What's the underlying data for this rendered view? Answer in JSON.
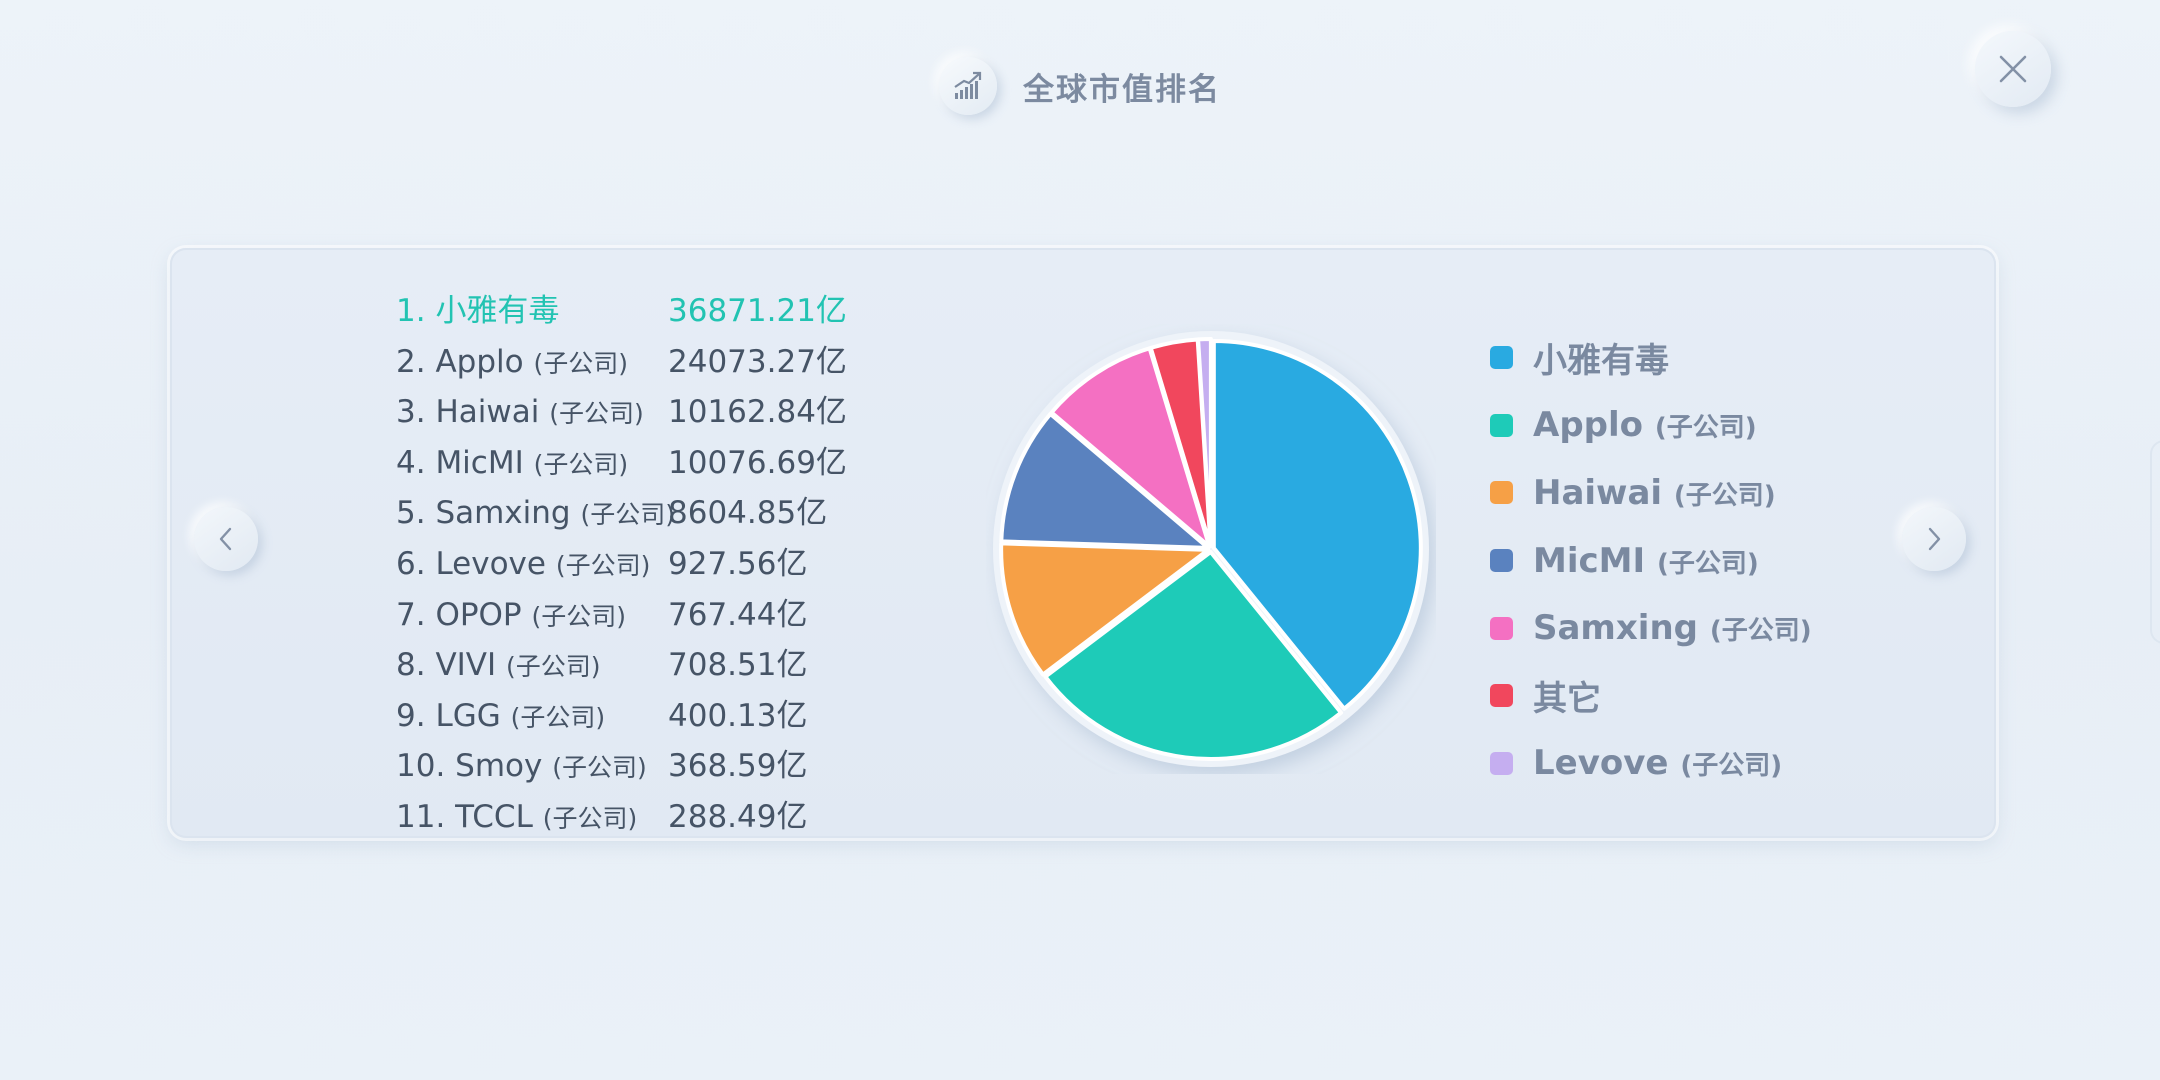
{
  "header": {
    "title": "全球市值排名",
    "icon": "growth-chart-icon"
  },
  "controls": {
    "close_icon": "close-icon",
    "prev_icon": "chevron-left-icon",
    "next_icon": "chevron-right-icon"
  },
  "ranking": [
    {
      "rank": "1.",
      "name": "小雅有毒",
      "tag": "",
      "value": "36871.21亿",
      "highlight": true
    },
    {
      "rank": "2.",
      "name": "Applo",
      "tag": "(子公司)",
      "value": "24073.27亿",
      "highlight": false
    },
    {
      "rank": "3.",
      "name": "Haiwai",
      "tag": "(子公司)",
      "value": "10162.84亿",
      "highlight": false
    },
    {
      "rank": "4.",
      "name": "MicMI",
      "tag": "(子公司)",
      "value": "10076.69亿",
      "highlight": false
    },
    {
      "rank": "5.",
      "name": "Samxing",
      "tag": "(子公司)",
      "value": "8604.85亿",
      "highlight": false
    },
    {
      "rank": "6.",
      "name": "Levove",
      "tag": "(子公司)",
      "value": "927.56亿",
      "highlight": false
    },
    {
      "rank": "7.",
      "name": "OPOP",
      "tag": "(子公司)",
      "value": "767.44亿",
      "highlight": false
    },
    {
      "rank": "8.",
      "name": "VIVI",
      "tag": "(子公司)",
      "value": "708.51亿",
      "highlight": false
    },
    {
      "rank": "9.",
      "name": "LGG",
      "tag": "(子公司)",
      "value": "400.13亿",
      "highlight": false
    },
    {
      "rank": "10.",
      "name": "Smoy",
      "tag": "(子公司)",
      "value": "368.59亿",
      "highlight": false
    },
    {
      "rank": "11.",
      "name": "TCCL",
      "tag": "(子公司)",
      "value": "288.49亿",
      "highlight": false
    }
  ],
  "chart_data": {
    "type": "pie",
    "title": "",
    "unit": "亿",
    "start": "12 o'clock, clockwise",
    "slices": [
      {
        "name": "小雅有毒",
        "tag": "",
        "value": 36871.21,
        "color": "#29aae1"
      },
      {
        "name": "Applo",
        "tag": "(子公司)",
        "value": 24073.27,
        "color": "#1ecbb8"
      },
      {
        "name": "Haiwai",
        "tag": "(子公司)",
        "value": 10162.84,
        "color": "#f6a046"
      },
      {
        "name": "MicMI",
        "tag": "(子公司)",
        "value": 10076.69,
        "color": "#5a82bf"
      },
      {
        "name": "Samxing",
        "tag": "(子公司)",
        "value": 8604.85,
        "color": "#f470c2"
      },
      {
        "name": "其它",
        "tag": "",
        "value": 3460.63,
        "color": "#f1475d"
      },
      {
        "name": "Levove",
        "tag": "(子公司)",
        "value": 927.56,
        "color": "#c5aef0"
      }
    ],
    "legend_position": "right"
  }
}
